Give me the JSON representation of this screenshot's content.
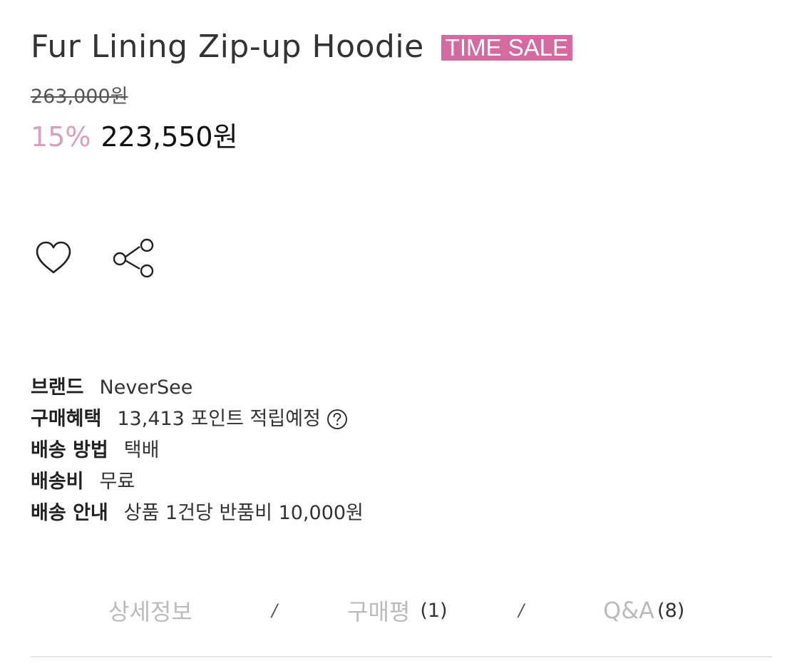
{
  "product": {
    "title": "Fur Lining Zip-up Hoodie",
    "badge": "TIME SALE",
    "original_price": "263,000원",
    "discount_rate": "15%",
    "sale_price": "223,550원"
  },
  "actions": {
    "wish_icon": "heart-icon",
    "share_icon": "share-icon"
  },
  "info": [
    {
      "label": "브랜드",
      "value": "NeverSee"
    },
    {
      "label": "구매혜택",
      "value": "13,413 포인트 적립예정",
      "help_icon": "question-circle-icon"
    },
    {
      "label": "배송 방법",
      "value": "택배"
    },
    {
      "label": "배송비",
      "value": "무료"
    },
    {
      "label": "배송 안내",
      "value": "상품 1건당 반품비 10,000원"
    }
  ],
  "tabs": {
    "separator": "/",
    "items": [
      {
        "label": "상세정보",
        "count": ""
      },
      {
        "label": "구매평",
        "count": "(1)"
      },
      {
        "label": "Q&A",
        "count": "(8)"
      }
    ]
  },
  "colors": {
    "badge_bg": "#d36aa0",
    "discount": "#d7a1bd",
    "tab_inactive": "#bbbbbb"
  }
}
